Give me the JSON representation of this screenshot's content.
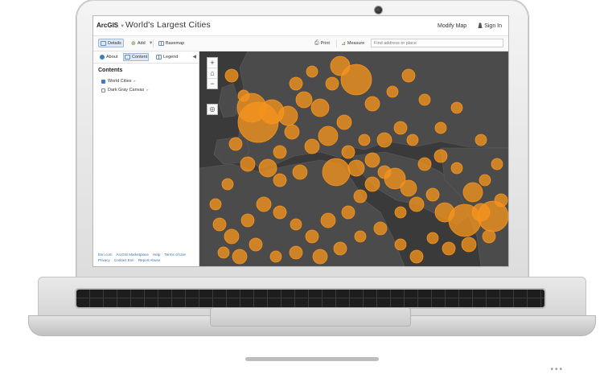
{
  "app": {
    "logo": "ArcGIS",
    "title": "World's Largest Cities"
  },
  "header": {
    "modify_map": "Modify Map",
    "sign_in": "Sign In"
  },
  "toolbar": {
    "details": "Details",
    "add": "Add",
    "basemap": "Basemap",
    "print": "Print",
    "measure": "Measure",
    "search_placeholder": "Find address or place"
  },
  "sidebar": {
    "tabs": [
      {
        "label": "About"
      },
      {
        "label": "Content"
      },
      {
        "label": "Legend"
      }
    ],
    "contents_heading": "Contents",
    "layers": [
      {
        "label": "World Cities"
      },
      {
        "label": "Dark Gray Canvas"
      }
    ],
    "footer": {
      "esri": "Esri.com",
      "marketplace": "ArcGIS Marketplace",
      "help": "Help",
      "terms": "Terms of Use",
      "privacy": "Privacy",
      "contact": "Contact Esri",
      "report": "Report Abuse"
    }
  },
  "map": {
    "zoom_in": "+",
    "zoom_out": "−",
    "land_color": "#4b4b4b",
    "sea_color": "#3a3a3a",
    "border_color": "#5e5e5e",
    "symbol_color": "#f5931e"
  }
}
